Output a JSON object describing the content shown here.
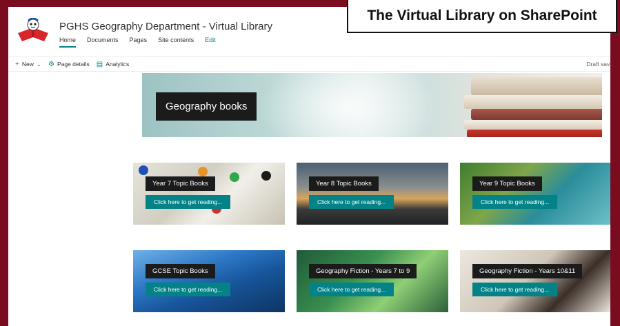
{
  "banner": {
    "title": "The Virtual Library on SharePoint"
  },
  "site": {
    "title": "PGHS Geography Department - Virtual Library",
    "nav": [
      {
        "label": "Home",
        "active": true
      },
      {
        "label": "Documents"
      },
      {
        "label": "Pages"
      },
      {
        "label": "Site contents"
      },
      {
        "label": "Edit"
      }
    ]
  },
  "command_bar": {
    "new_label": "New",
    "page_details_label": "Page details",
    "analytics_label": "Analytics",
    "status": "Draft save"
  },
  "hero": {
    "title": "Geography books"
  },
  "tiles": [
    {
      "title": "Year 7 Topic Books",
      "button": "Click here to get reading..."
    },
    {
      "title": "Year 8 Topic Books",
      "button": "Click here to get reading..."
    },
    {
      "title": "Year 9 Topic Books",
      "button": "Click here to get reading..."
    },
    {
      "title": "GCSE Topic Books",
      "button": "Click here to get reading..."
    },
    {
      "title": "Geography Fiction - Years 7 to 9",
      "button": "Click here to get reading..."
    },
    {
      "title": "Geography Fiction - Years 10&11",
      "button": "Click here to get reading..."
    }
  ],
  "colors": {
    "accent": "#038387",
    "frame": "#7a0c20"
  }
}
